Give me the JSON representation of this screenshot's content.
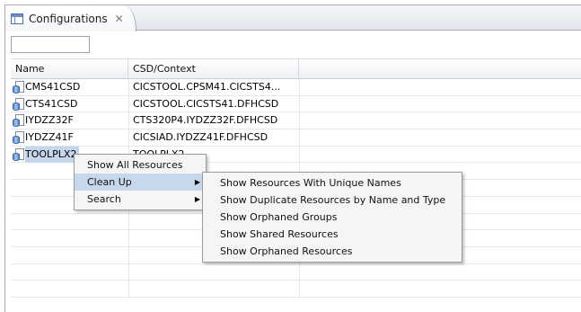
{
  "view": {
    "tab_title": "Configurations",
    "tab_close": "✕",
    "filter": {
      "value": "",
      "placeholder": ""
    }
  },
  "table": {
    "columns": [
      "Name",
      "CSD/Context"
    ],
    "rows": [
      {
        "name": "CMS41CSD",
        "context": "CICSTOOL.CPSM41.CICSTS4..."
      },
      {
        "name": "CTS41CSD",
        "context": "CICSTOOL.CICSTS41.DFHCSD"
      },
      {
        "name": "IYDZZ32F",
        "context": "CTS320P4.IYDZZ32F.DFHCSD"
      },
      {
        "name": "IYDZZ41F",
        "context": "CICSIAD.IYDZZ41F.DFHCSD"
      },
      {
        "name": "TOOLPLX2",
        "context": "TOOLPLX2"
      }
    ]
  },
  "context_menu": {
    "items": [
      {
        "label": "Show All Resources"
      },
      {
        "label": "Clean Up",
        "arrow": "▶"
      },
      {
        "label": "Search",
        "arrow": "▶"
      }
    ]
  },
  "submenu": {
    "items": [
      {
        "label": "Show Resources With Unique Names"
      },
      {
        "label": "Show Duplicate Resources by Name and Type"
      },
      {
        "label": "Show Orphaned Groups"
      },
      {
        "label": "Show Shared Resources"
      },
      {
        "label": "Show Orphaned Resources"
      }
    ]
  },
  "colors": {
    "selection": "#c5d5ea",
    "menu_highlight": "#c7d7ec",
    "border": "#a5acb5"
  },
  "icons": {
    "tab": "configurations-view-icon",
    "row": "csd-database-icon",
    "submenu_arrow": "submenu-arrow-icon"
  }
}
